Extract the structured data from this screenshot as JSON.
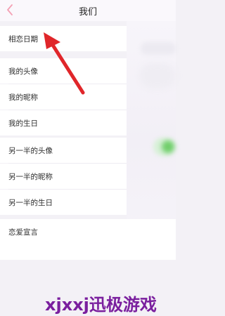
{
  "nav": {
    "title": "我们"
  },
  "rows": {
    "date": "相恋日期",
    "my_avatar": "我的头像",
    "my_nickname": "我的昵称",
    "my_birthday": "我的生日",
    "partner_avatar": "另一半的头像",
    "partner_nickname": "另一半的昵称",
    "partner_birthday": "另一半的生日",
    "declaration": "恋爱宣言"
  },
  "watermark": "xjxxj迅极游戏",
  "colors": {
    "back_chevron": "#f4a1b4",
    "arrow": "#e0262a",
    "toggle_on": "#6fce6a",
    "watermark": "#7a1f9e"
  },
  "icons": {
    "back": "chevron-left-icon",
    "annotation": "red-arrow-icon"
  }
}
